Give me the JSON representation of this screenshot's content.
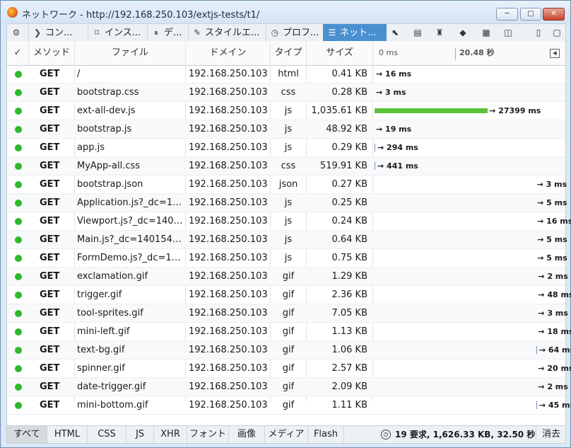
{
  "window": {
    "title": "ネットワーク - http://192.168.250.103/extjs-tests/t1/",
    "minimize": "─",
    "maximize": "□",
    "close": "✕"
  },
  "toolbar": {
    "tools": [
      {
        "label": "",
        "icon": "gear-icon"
      },
      {
        "label": "コン...",
        "icon": "console-icon"
      },
      {
        "label": "インス...",
        "icon": "inspector-icon"
      },
      {
        "label": "デ...",
        "icon": "debugger-icon"
      },
      {
        "label": "スタイルエ...",
        "icon": "style-editor-icon"
      },
      {
        "label": "プロフ...",
        "icon": "profiler-icon"
      },
      {
        "label": "ネット...",
        "icon": "network-icon"
      }
    ],
    "right_icons": [
      "pick-element-icon",
      "split-console-icon",
      "paintbrush-icon",
      "3d-view-icon",
      "clapper-icon",
      "screenshot-icon",
      "dock-side-icon",
      "undock-icon"
    ]
  },
  "columns": {
    "check": "✓",
    "method": "メソッド",
    "file": "ファイル",
    "domain": "ドメイン",
    "type": "タイプ",
    "size": "サイズ",
    "timeline_start": "0 ms",
    "timeline_mark": "20.48 秒"
  },
  "requests": [
    {
      "method": "GET",
      "file": "/",
      "domain": "192.168.250.103",
      "type": "html",
      "size": "0.41 KB",
      "time": "→ 16 ms",
      "start": 0,
      "duration": 16,
      "bar": "none"
    },
    {
      "method": "GET",
      "file": "bootstrap.css",
      "domain": "192.168.250.103",
      "type": "css",
      "size": "0.28 KB",
      "time": "→ 3 ms",
      "start": 0,
      "duration": 3,
      "bar": "none"
    },
    {
      "method": "GET",
      "file": "ext-all-dev.js",
      "domain": "192.168.250.103",
      "type": "js",
      "size": "1,035.61 KB",
      "time": "→ 27399 ms",
      "start": 0,
      "duration": 27399,
      "bar": "green"
    },
    {
      "method": "GET",
      "file": "bootstrap.js",
      "domain": "192.168.250.103",
      "type": "js",
      "size": "48.92 KB",
      "time": "→ 19 ms",
      "start": 0,
      "duration": 19,
      "bar": "none"
    },
    {
      "method": "GET",
      "file": "app.js",
      "domain": "192.168.250.103",
      "type": "js",
      "size": "0.29 KB",
      "time": "→ 294 ms",
      "start": 0,
      "duration": 294,
      "bar": "tick"
    },
    {
      "method": "GET",
      "file": "MyApp-all.css",
      "domain": "192.168.250.103",
      "type": "css",
      "size": "519.91 KB",
      "time": "→ 441 ms",
      "start": 0,
      "duration": 441,
      "bar": "tick"
    },
    {
      "method": "GET",
      "file": "bootstrap.json",
      "domain": "192.168.250.103",
      "type": "json",
      "size": "0.27 KB",
      "time": "→ 3 ms",
      "start": 27400,
      "duration": 3,
      "bar": "none"
    },
    {
      "method": "GET",
      "file": "Application.js?_dc=1401543...",
      "domain": "192.168.250.103",
      "type": "js",
      "size": "0.25 KB",
      "time": "→ 5 ms",
      "start": 27450,
      "duration": 5,
      "bar": "none"
    },
    {
      "method": "GET",
      "file": "Viewport.js?_dc=14015432...",
      "domain": "192.168.250.103",
      "type": "js",
      "size": "0.24 KB",
      "time": "→ 16 ms",
      "start": 27460,
      "duration": 16,
      "bar": "none"
    },
    {
      "method": "GET",
      "file": "Main.js?_dc=1401543249...",
      "domain": "192.168.250.103",
      "type": "js",
      "size": "0.64 KB",
      "time": "→ 5 ms",
      "start": 27470,
      "duration": 5,
      "bar": "none"
    },
    {
      "method": "GET",
      "file": "FormDemo.js?_dc=1401543...",
      "domain": "192.168.250.103",
      "type": "js",
      "size": "0.75 KB",
      "time": "→ 5 ms",
      "start": 27470,
      "duration": 5,
      "bar": "none"
    },
    {
      "method": "GET",
      "file": "exclamation.gif",
      "domain": "192.168.250.103",
      "type": "gif",
      "size": "1.29 KB",
      "time": "→ 2 ms",
      "start": 27600,
      "duration": 2,
      "bar": "none"
    },
    {
      "method": "GET",
      "file": "trigger.gif",
      "domain": "192.168.250.103",
      "type": "gif",
      "size": "2.36 KB",
      "time": "→ 48 ms",
      "start": 27600,
      "duration": 48,
      "bar": "none"
    },
    {
      "method": "GET",
      "file": "tool-sprites.gif",
      "domain": "192.168.250.103",
      "type": "gif",
      "size": "7.05 KB",
      "time": "→ 3 ms",
      "start": 27600,
      "duration": 3,
      "bar": "none"
    },
    {
      "method": "GET",
      "file": "mini-left.gif",
      "domain": "192.168.250.103",
      "type": "gif",
      "size": "1.13 KB",
      "time": "→ 18 ms",
      "start": 27600,
      "duration": 18,
      "bar": "none"
    },
    {
      "method": "GET",
      "file": "text-bg.gif",
      "domain": "192.168.250.103",
      "type": "gif",
      "size": "1.06 KB",
      "time": "→ 64 ms",
      "start": 27550,
      "duration": 64,
      "bar": "tick"
    },
    {
      "method": "GET",
      "file": "spinner.gif",
      "domain": "192.168.250.103",
      "type": "gif",
      "size": "2.57 KB",
      "time": "→ 20 ms",
      "start": 27600,
      "duration": 20,
      "bar": "none"
    },
    {
      "method": "GET",
      "file": "date-trigger.gif",
      "domain": "192.168.250.103",
      "type": "gif",
      "size": "2.09 KB",
      "time": "→ 2 ms",
      "start": 27600,
      "duration": 2,
      "bar": "none"
    },
    {
      "method": "GET",
      "file": "mini-bottom.gif",
      "domain": "192.168.250.103",
      "type": "gif",
      "size": "1.11 KB",
      "time": "→ 45 ms",
      "start": 27550,
      "duration": 45,
      "bar": "tick"
    }
  ],
  "filters": [
    "すべて",
    "HTML",
    "CSS",
    "JS",
    "XHR",
    "フォント",
    "画像",
    "メディア",
    "Flash"
  ],
  "summary": "19 要求, 1,626.33 KB, 32.50 秒",
  "clear_label": "消去",
  "colors": {
    "accent": "#4a90d0",
    "ok": "#2fb82f",
    "bar": "#5cc23a"
  }
}
